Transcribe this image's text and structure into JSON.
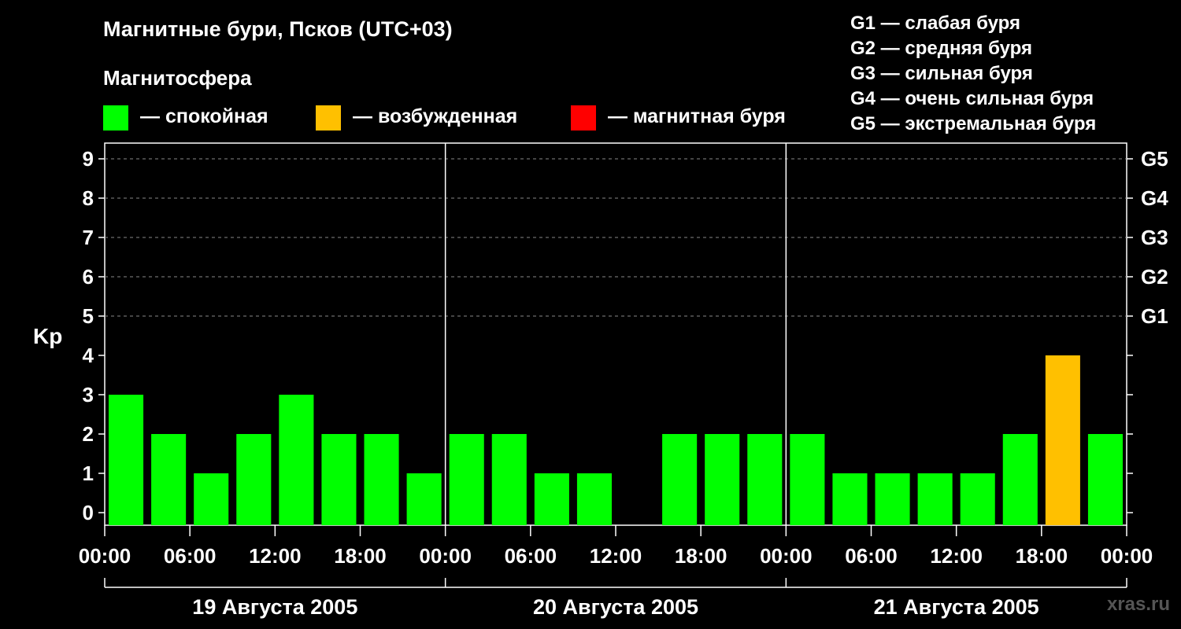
{
  "header": {
    "title": "Магнитные бури, Псков (UTC+03)",
    "subtitle": "Магнитосфера"
  },
  "legend": [
    {
      "label": "— спокойная",
      "color": "#00ff00"
    },
    {
      "label": "— возбужденная",
      "color": "#ffc000"
    },
    {
      "label": "— магнитная буря",
      "color": "#ff0000"
    }
  ],
  "g_legend": [
    "G1 — слабая буря",
    "G2 — средняя буря",
    "G3 — сильная буря",
    "G4 — очень сильная буря",
    "G5 — экстремальная буря"
  ],
  "watermark": "xras.ru",
  "chart_data": {
    "type": "bar",
    "title": "Магнитные бури, Псков (UTC+03)",
    "subtitle": "Магнитосфера",
    "ylabel": "Kp",
    "ylim": [
      0,
      9
    ],
    "y_ticks": [
      "0",
      "1",
      "2",
      "3",
      "4",
      "5",
      "6",
      "7",
      "8",
      "9"
    ],
    "right_ticks": [
      {
        "value": 5,
        "label": "G1"
      },
      {
        "value": 6,
        "label": "G2"
      },
      {
        "value": 7,
        "label": "G3"
      },
      {
        "value": 8,
        "label": "G4"
      },
      {
        "value": 9,
        "label": "G5"
      }
    ],
    "x_tick_labels": [
      "00:00",
      "06:00",
      "12:00",
      "18:00",
      "00:00",
      "06:00",
      "12:00",
      "18:00",
      "00:00",
      "06:00",
      "12:00",
      "18:00",
      "00:00"
    ],
    "days": [
      "19 Августа 2005",
      "20 Августа 2005",
      "21 Августа 2005"
    ],
    "values": [
      3,
      2,
      1,
      2,
      3,
      2,
      2,
      1,
      2,
      2,
      1,
      1,
      0,
      2,
      2,
      2,
      2,
      1,
      1,
      1,
      1,
      2,
      4,
      2
    ],
    "colors": {
      "quiet": "#00ff00",
      "active": "#ffc000",
      "storm": "#ff0000"
    },
    "grid": "dashed horizontal at 5–9"
  }
}
